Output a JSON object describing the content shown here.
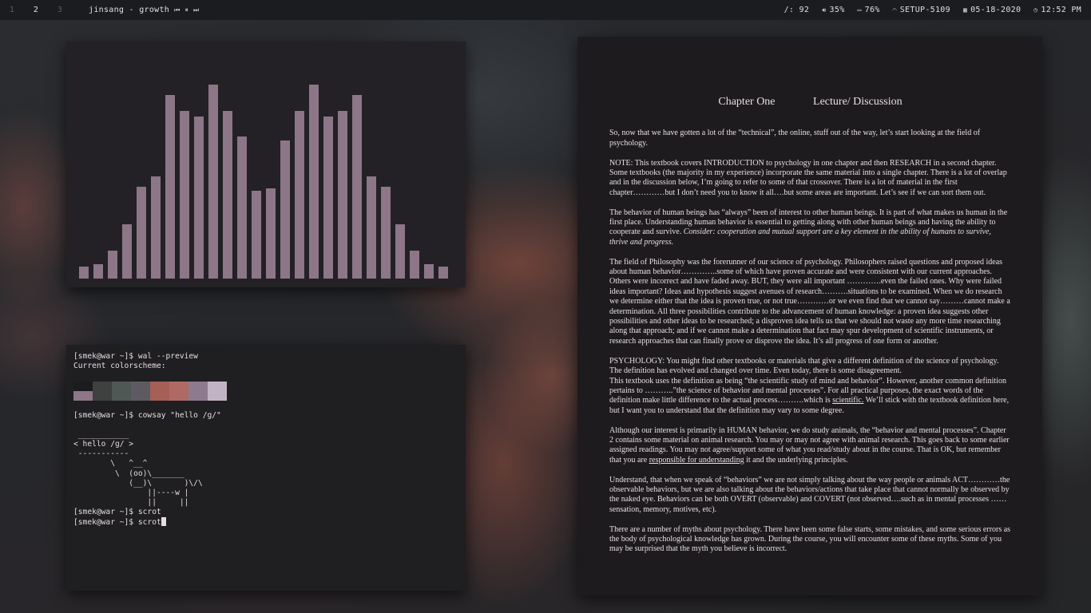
{
  "topbar": {
    "workspaces": [
      "1",
      "2",
      "3"
    ],
    "now_playing": "jinsang - growth",
    "controls": {
      "prev": "⏮",
      "pause": "⏸",
      "next": "⏭"
    },
    "status": {
      "disk": "/: 92",
      "volume": "35%",
      "battery": "76%",
      "network": "SETUP-5109",
      "date": "05-18-2020",
      "time": "12:52 PM"
    },
    "icons": {
      "volume": "volume-icon",
      "battery": "battery-icon",
      "wifi": "wifi-icon",
      "calendar": "calendar-icon",
      "clock": "clock-icon"
    }
  },
  "visualizer": {
    "bar_color": "#8d7688",
    "levels": [
      0.06,
      0.07,
      0.14,
      0.27,
      0.46,
      0.51,
      0.92,
      0.84,
      0.81,
      0.97,
      0.84,
      0.71,
      0.44,
      0.45,
      0.69,
      0.84,
      0.97,
      0.81,
      0.84,
      0.92,
      0.51,
      0.46,
      0.27,
      0.14,
      0.07,
      0.06
    ]
  },
  "terminal": {
    "lines": [
      "[smek@war ~]$ wal --preview",
      "Current colorscheme:"
    ],
    "palette_top": [
      "#1c1b1e",
      "#3f4040",
      "#4f5855",
      "#5e5a61",
      "#a55f55",
      "#b06a66",
      "#8e7a8e",
      "#c2b3c4"
    ],
    "palette_bottom": [
      "#8d7688"
    ],
    "cowsay_lines": [
      "[smek@war ~]$ cowsay \"hello /g/\"",
      " ___________",
      "< hello /g/ >",
      " -----------",
      "        \\   ^__^",
      "         \\  (oo)\\_______",
      "            (__)\\       )\\/\\",
      "                ||----w |",
      "                ||     ||",
      "[smek@war ~]$ scrot",
      "[smek@war ~]$ scrot"
    ]
  },
  "document": {
    "title_left": "Chapter One",
    "title_right": "Lecture/ Discussion",
    "p1": "So, now that we have gotten a lot of the “technical”, the online, stuff out of the way, let’s start looking at the field of psychology.",
    "p2": "NOTE:  This textbook covers INTRODUCTION to psychology in one chapter and then RESEARCH in a second chapter. Some textbooks (the majority in my experience) incorporate the same material into a single chapter.  There is a lot of overlap and in the discussion below, I’m going to refer to some of that crossover. There is a lot of material in the first chapter…………but I don’t need you to know it all….but some areas are important.  Let’s see if we can sort them out.",
    "p3a": "The behavior of human beings has “always” been of interest to other human beings. It is part of what makes us human in the first place. Understanding human behavior is essential to getting along with other human beings and having the ability to cooperate and survive.",
    "p3b": "Consider:  cooperation and mutual support are a key element in the ability of humans to survive, thrive and progress.",
    "p4": "The field of Philosophy was the forerunner of our science of psychology.  Philosophers raised questions and proposed ideas about human behavior…………..some of which have proven accurate and were consistent with our current approaches.  Others were incorrect and have faded away.  BUT, they were all important ………….even the failed ones.  Why were failed ideas important?  Ideas and hypothesis suggest avenues of research……….situations to be examined.  When we do research we determine either that the idea is proven true, or not true…………or we even find that we cannot say………cannot make a determination.  All three possibilities contribute to the advancement of human knowledge:  a proven idea suggests other possibilities and other ideas to be researched; a disproven idea tells us that we should not waste any more time researching along that approach; and if we cannot make a determination that fact may spur development of scientific instruments, or research approaches that can finally prove or disprove the idea.  It’s all progress of one form or another.",
    "p5a": "PSYCHOLOGY: You might find other textbooks or materials that give a different definition of the science of psychology. The definition has evolved and changed over time.  Even today, there is some disagreement.",
    "p5b": "This textbook uses the definition as being “the scientific study of mind and behavior”. However, another common definition pertains to ………..”the science of behavior and mental processes”.  For all practical purposes, the exact words of the definition make little difference to the actual process……….which is",
    "p5u": "scientific.",
    "p5c": " We’ll stick with the textbook definition here, but I want you to understand that the definition may vary to some degree.",
    "p6a": "Although our interest is primarily in HUMAN behavior, we do study animals, the “behavior and mental processes”.  Chapter 2 contains some material on animal research. You may or may not agree with animal research. This goes back to some earlier assigned readings.  You may not agree/support some of what you read/study about in the course.  That is OK, but remember that you are",
    "p6u": "responsible for understanding",
    "p6c": " it and the underlying principles.",
    "p7": "Understand, that when we speak of “behaviors” we are not simply talking about the way people or animals ACT…………the observable behaviors, but we are also talking about the behaviors/actions that take place that cannot normally be observed by the naked eye.  Behaviors can be both OVERT (observable) and COVERT (not observed….such as in mental processes ……sensation, memory, motives, etc).",
    "p8": "There are a number of myths about psychology.  There have been some false starts, some mistakes, and some serious errors as the body of psychological knowledge has grown. During the course, you will encounter some of these myths.  Some of you may be surprised that the myth you believe is incorrect."
  }
}
